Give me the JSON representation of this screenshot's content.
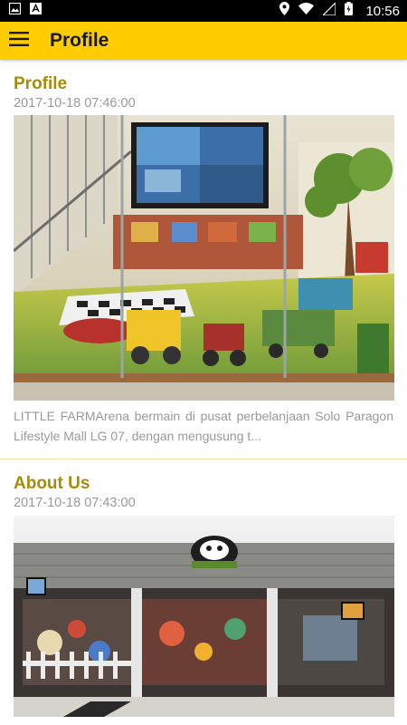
{
  "status_bar": {
    "time": "10:56",
    "left_icons": [
      "image-icon",
      "app-notification-icon"
    ],
    "right_icons": [
      "location-icon",
      "wifi-icon",
      "signal-icon",
      "battery-icon"
    ]
  },
  "app_bar": {
    "title": "Profile",
    "menu_icon": "hamburger-menu-icon",
    "accent_color": "#FFCC00"
  },
  "posts": [
    {
      "title": "Profile",
      "date": "2017-10-18 07:46:00",
      "excerpt": "LITTLE FARMArena bermain di pusat perbelanjaan Solo Paragon Lifestyle Mall LG 07, dengan mengusung t..."
    },
    {
      "title": "About Us",
      "date": "2017-10-18 07:43:00",
      "excerpt": ""
    }
  ],
  "colors": {
    "title_color": "#a58c0a",
    "meta_color": "#9a9a9a",
    "divider_color": "#f3e3a6"
  }
}
